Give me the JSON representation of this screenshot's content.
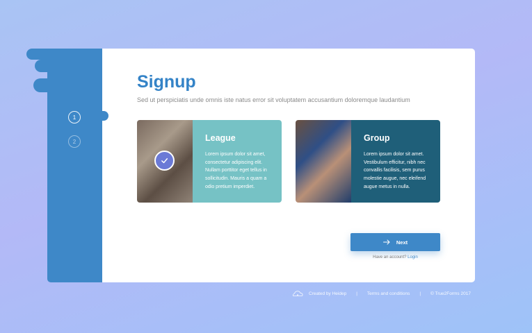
{
  "title": "Signup",
  "subtitle": "Sed ut perspiciatis unde omnis iste natus error sit voluptatem accusantium doloremque laudantium",
  "steps": [
    "1",
    "2"
  ],
  "options": [
    {
      "heading": "League",
      "text": "Lorem ipsum dolor sit amet, consectetur adipiscing elit. Nullam porttitor eget tellus in sollicitudin. Mauris a quam a odio pretium imperdiet.",
      "selected": true
    },
    {
      "heading": "Group",
      "text": "Lorem ipsum dolor sit amet. Vestibulum efficitur, nibh nec convallis facilisis, sem purus molestie augue, nec eleifend augue metus in nulla.",
      "selected": false
    }
  ],
  "next_label": "Next",
  "login_prompt": "Have an account?",
  "login_link": "Login",
  "footer": {
    "created_by": "Created by Heidep",
    "terms": "Terms and conditions",
    "copyright": "© True2Forms 2017"
  },
  "colors": {
    "primary": "#3e88c8",
    "league_card": "#76c2c5",
    "group_card": "#1f5f79",
    "check": "#6b7ad6"
  }
}
